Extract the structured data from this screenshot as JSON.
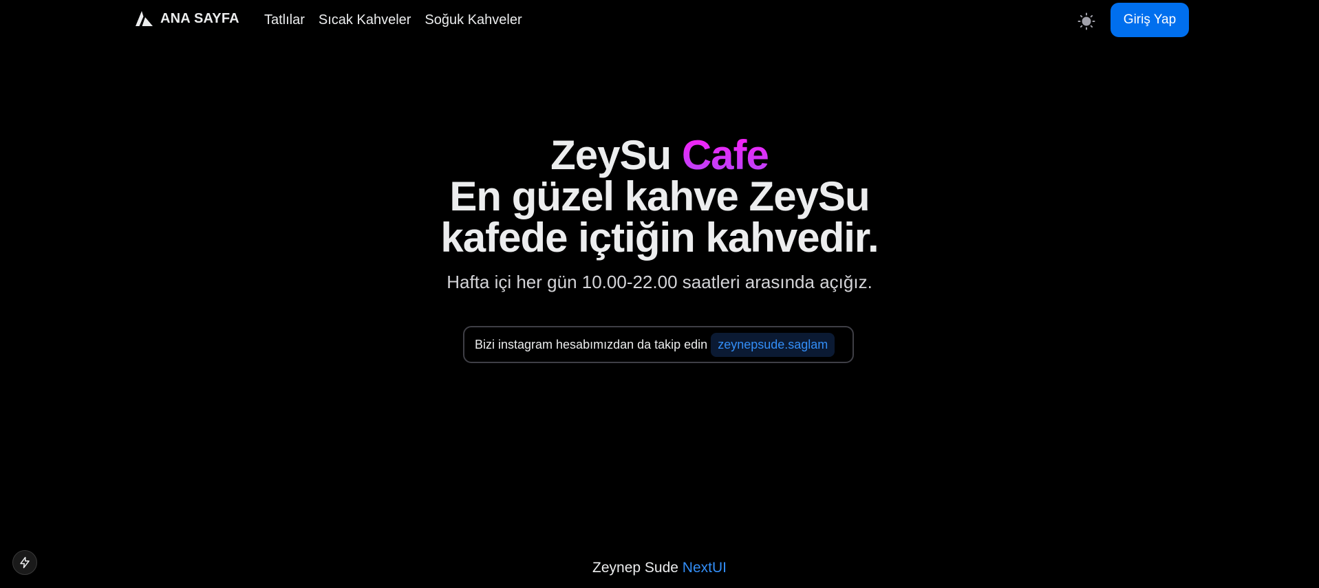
{
  "navbar": {
    "brand_label": "ANA SAYFA",
    "links": [
      {
        "label": "Tatlılar"
      },
      {
        "label": "Sıcak Kahveler"
      },
      {
        "label": "Soğuk Kahveler"
      }
    ],
    "theme_icon": "sun-icon",
    "login_label": "Giriş Yap"
  },
  "hero": {
    "title_part1": "ZeySu",
    "title_accent": "Cafe",
    "title_line2": "En güzel kahve ZeySu",
    "title_line3": "kafede içtiğin kahvedir.",
    "subtitle": "Hafta içi her gün 10.00-22.00 saatleri arasında açığız."
  },
  "snippet": {
    "text": "Bizi instagram hesabımızdan da takip edin",
    "code": "zeynepsude.saglam"
  },
  "footer": {
    "name": "Zeynep Sude",
    "link": "NextUI"
  },
  "dev_indicator": {
    "icon": "lightning-icon"
  },
  "colors": {
    "background": "#000000",
    "text": "#ECEDEE",
    "primary": "#006FEE",
    "link": "#338EF7",
    "accent_gradient_start": "#FF1CF7",
    "accent_gradient_end": "#B249F8"
  }
}
